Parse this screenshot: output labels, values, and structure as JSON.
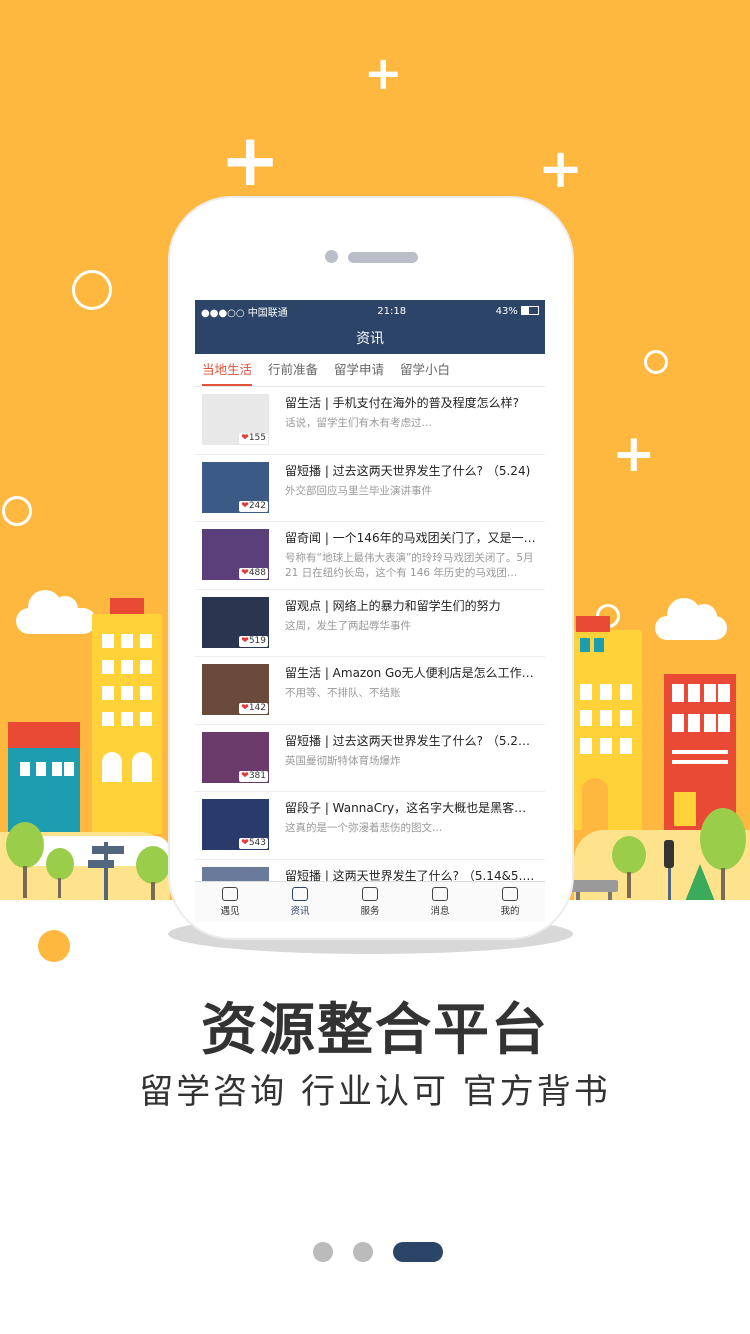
{
  "status_bar": {
    "carrier": "●●●○○ 中国联通",
    "time": "21:18",
    "battery": "43%"
  },
  "nav": {
    "title": "资讯"
  },
  "tabs": [
    {
      "label": "当地生活",
      "active": true
    },
    {
      "label": "行前准备",
      "active": false
    },
    {
      "label": "留学申请",
      "active": false
    },
    {
      "label": "留学小白",
      "active": false
    }
  ],
  "articles": [
    {
      "title": "留生活 | 手机支付在海外的普及程度怎么样?",
      "desc": "话说，留学生们有木有考虑过…",
      "likes": "155",
      "thumb_color": "#e8e8e8"
    },
    {
      "title": "留短播 | 过去这两天世界发生了什么? （5.24)",
      "desc": "外交部回应马里兰毕业演讲事件",
      "likes": "242",
      "thumb_color": "#3b5a86"
    },
    {
      "title": "留奇闻 | 一个146年的马戏团关门了，又是一…",
      "desc": "号称有“地球上最伟大表演”的玲玲马戏团关闭了。5月 21 日在纽约长岛，这个有 146 年历史的马戏团…",
      "likes": "488",
      "thumb_color": "#5a3f7a"
    },
    {
      "title": "留观点 | 网络上的暴力和留学生们的努力",
      "desc": "这周，发生了两起辱华事件",
      "likes": "519",
      "thumb_color": "#2a3550"
    },
    {
      "title": "留生活 | Amazon Go无人便利店是怎么工作…",
      "desc": "不用等、不排队、不结账",
      "likes": "142",
      "thumb_color": "#6a4a3a"
    },
    {
      "title": "留短播 | 过去这两天世界发生了什么? （5.20…",
      "desc": "英国曼彻斯特体育场爆炸",
      "likes": "381",
      "thumb_color": "#6a3a6a"
    },
    {
      "title": "留段子 | WannaCry，这名字大概也是黑客组…",
      "desc": "这真的是一个弥漫着悲伤的图文…",
      "likes": "543",
      "thumb_color": "#2a3a6a"
    },
    {
      "title": "留短播 | 这两天世界发生了什么? （5.14&5.1…",
      "desc": "",
      "likes": "",
      "thumb_color": "#6a7a9a"
    }
  ],
  "tabbar": [
    {
      "label": "遇见",
      "icon": "signpost-icon",
      "active": false
    },
    {
      "label": "资讯",
      "icon": "news-icon",
      "active": true
    },
    {
      "label": "服务",
      "icon": "flower-icon",
      "active": false
    },
    {
      "label": "消息",
      "icon": "message-icon",
      "active": false
    },
    {
      "label": "我的",
      "icon": "profile-icon",
      "active": false
    }
  ],
  "headline": "资源整合平台",
  "subline": "留学咨询 行业认可 官方背书",
  "colors": {
    "background_yellow": "#FFB83F",
    "nav_blue": "#2B4468",
    "tab_active_red": "#E2533A"
  },
  "pager": {
    "pages": 3,
    "current": 3
  }
}
